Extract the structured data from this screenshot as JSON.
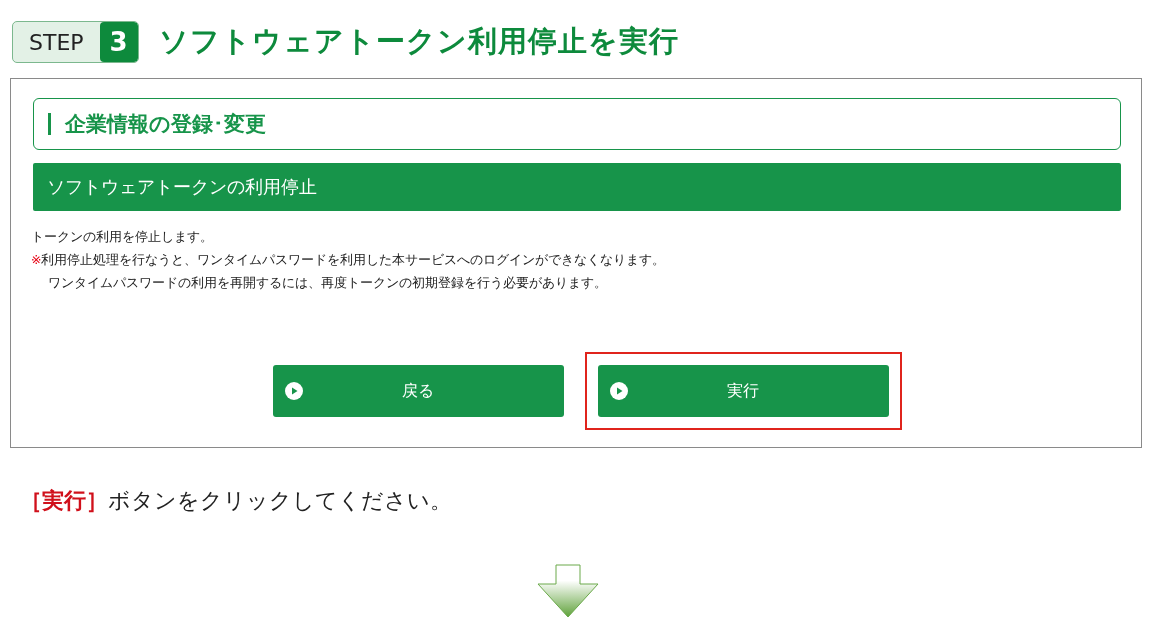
{
  "step": {
    "label": "STEP",
    "number": "3"
  },
  "title": "ソフトウェアトークン利用停止を実行",
  "screen": {
    "section_heading": "企業情報の登録･変更",
    "panel_title": "ソフトウェアトークンの利用停止",
    "messages": [
      {
        "kind": "plain",
        "text": "トークンの利用を停止します。"
      },
      {
        "kind": "note",
        "mark": "※",
        "text": "利用停止処理を行なうと、ワンタイムパスワードを利用した本サービスへのログインができなくなります。"
      },
      {
        "kind": "continuation",
        "text": "ワンタイムパスワードの利用を再開するには、再度トークンの初期登録を行う必要があります。"
      }
    ],
    "buttons": [
      {
        "label": "戻る",
        "highlighted": false
      },
      {
        "label": "実行",
        "highlighted": true
      }
    ]
  },
  "instruction": {
    "emphasis": "［実行］",
    "text": "ボタンをクリックしてください。"
  }
}
